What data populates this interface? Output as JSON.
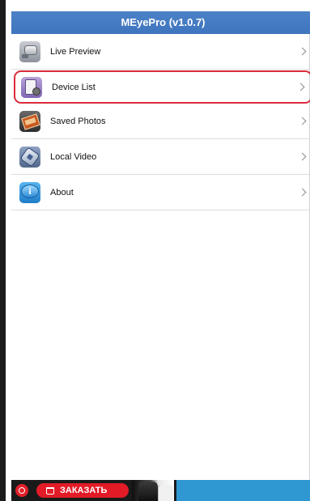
{
  "app": {
    "title": "MEyePro (v1.0.7)"
  },
  "menu": {
    "items": [
      {
        "label": "Live Preview",
        "icon": "camera-icon",
        "selected": false
      },
      {
        "label": "Device List",
        "icon": "device-list-icon",
        "selected": true
      },
      {
        "label": "Saved Photos",
        "icon": "photos-icon",
        "selected": false
      },
      {
        "label": "Local Video",
        "icon": "video-reel-icon",
        "selected": false
      },
      {
        "label": "About",
        "icon": "info-icon",
        "selected": false
      }
    ]
  },
  "ad": {
    "button_label": "ЗАКАЗАТЬ"
  },
  "colors": {
    "titlebar": "#4179c1",
    "selection_border": "#d92b3a",
    "ad_button": "#e21b27",
    "ad_background": "#2f97d1"
  }
}
